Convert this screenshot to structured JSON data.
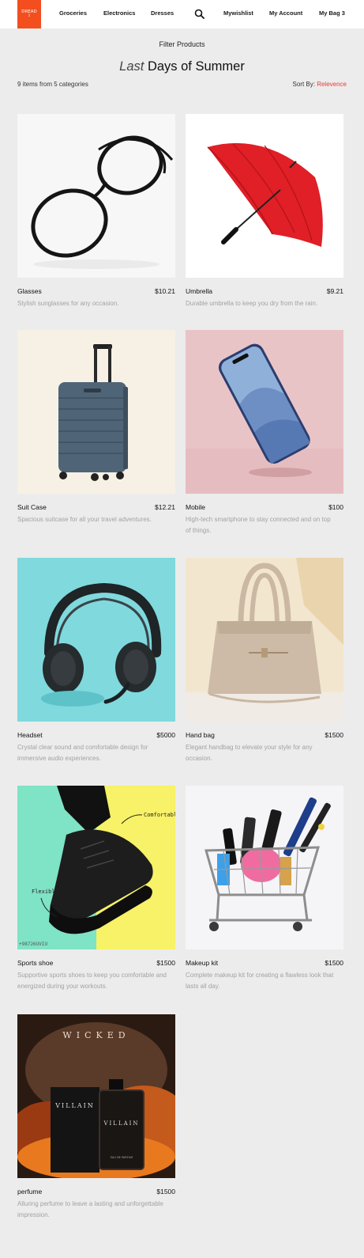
{
  "header": {
    "logo_line1": "DREAD",
    "logo_line2": "5",
    "nav": [
      "Groceries",
      "Electronics",
      "Dresses"
    ],
    "wishlist_label": "Mywishlist",
    "account_label": "My Account",
    "bag_label": "My Bag 3"
  },
  "filter_label": "Filter Products",
  "heading": {
    "italic": "Last",
    "rest": " Days of Summer"
  },
  "results": {
    "count_text": "9 items from 5 categories",
    "sort_prefix": "Sort By: ",
    "sort_value": "Relevence"
  },
  "products": [
    {
      "name": "Glasses",
      "price": "$10.21",
      "desc": "Stylish sunglasses for any occasion.",
      "icon": "glasses"
    },
    {
      "name": "Umbrella",
      "price": "$9.21",
      "desc": "Durable umbrella to keep you dry from the rain.",
      "icon": "umbrella"
    },
    {
      "name": "Suit Case",
      "price": "$12.21",
      "desc": "Spacious suitcase for all your travel adventures.",
      "icon": "suitcase"
    },
    {
      "name": "Mobile",
      "price": "$100",
      "desc": "High-tech smartphone to stay connected and on top of things.",
      "icon": "phone"
    },
    {
      "name": "Headset",
      "price": "$5000",
      "desc": "Crystal clear sound and comfortable design for immersive audio experiences.",
      "icon": "headset"
    },
    {
      "name": "Hand bag",
      "price": "$1500",
      "desc": "Elegant handbag to elevate your style for any occasion.",
      "icon": "handbag"
    },
    {
      "name": "Sports shoe",
      "price": "$1500",
      "desc": "Supportive sports shoes to keep you comfortable and energized during your workouts.",
      "icon": "shoe"
    },
    {
      "name": "Makeup kit",
      "price": "$1500",
      "desc": "Complete makeup kit for creating a flawless look that lasts all day.",
      "icon": "cart"
    },
    {
      "name": "perfume",
      "price": "$1500",
      "desc": "Alluring perfume to leave a lasting and unforgettable impression.",
      "icon": "perfume"
    }
  ],
  "image_text": {
    "shoe_comfortable": "Comfortable",
    "shoe_flexible": "Flexible",
    "shoe_code": "+98726UVIU",
    "perfume_wicked": "WICKED",
    "perfume_villain_box": "VILLAIN",
    "perfume_villain_bottle": "VILLAIN",
    "perfume_edp": "EAU DE PARFUM"
  },
  "colors": {
    "accent": "#f24e1e",
    "sort_value": "#e63a3a",
    "desc_text": "#a2a2a2"
  }
}
